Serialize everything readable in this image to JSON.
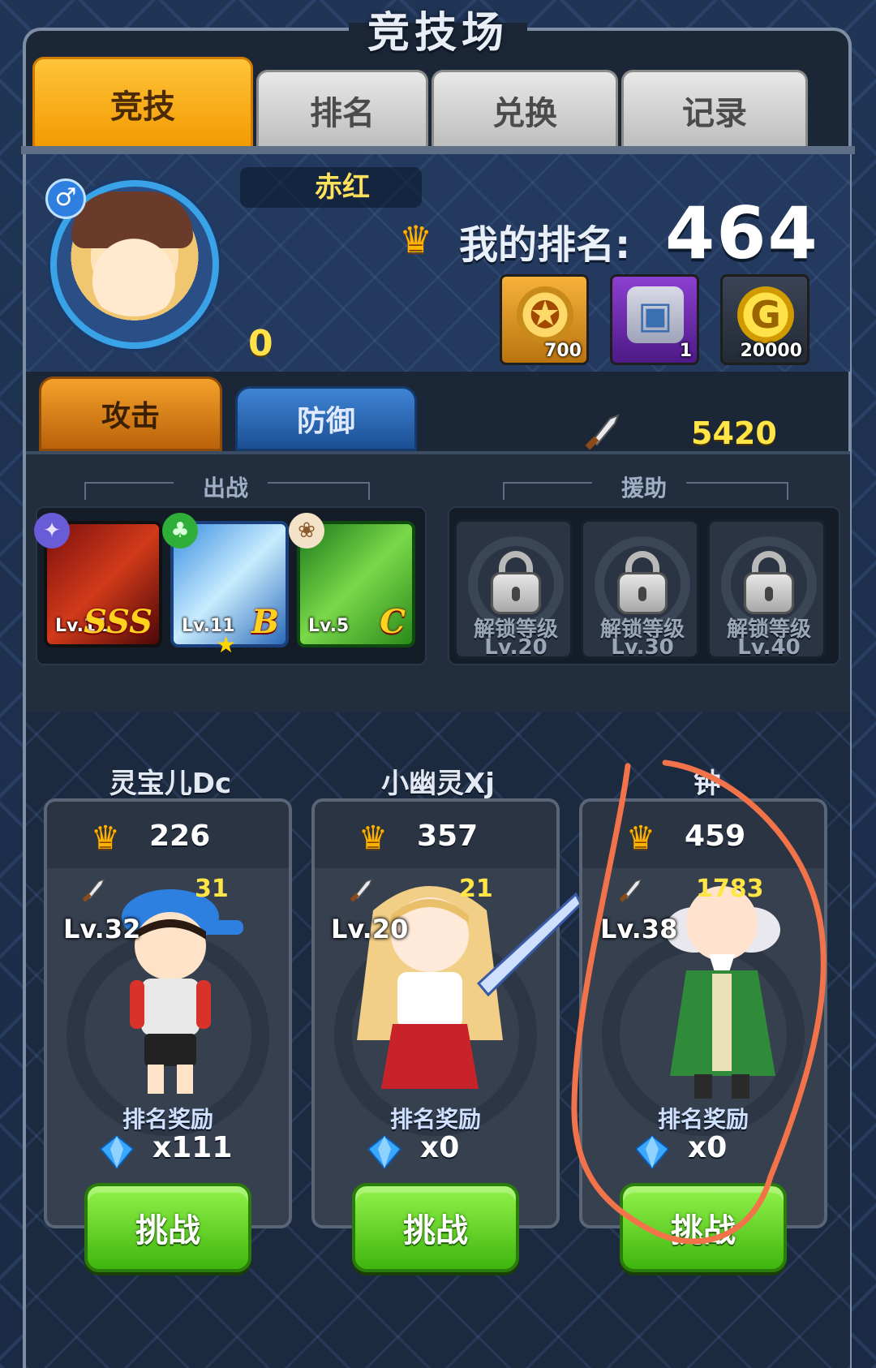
{
  "header": {
    "title": "竞技场"
  },
  "tabs": [
    {
      "label": "竞技",
      "active": true
    },
    {
      "label": "排名",
      "active": false
    },
    {
      "label": "兑换",
      "active": false
    },
    {
      "label": "记录",
      "active": false
    }
  ],
  "player": {
    "name": "赤红",
    "gender_icon": "male-icon",
    "points": "0",
    "rank_label": "我的排名:",
    "rank_value": "464",
    "rewards": [
      {
        "icon": "medal-icon",
        "qty": "700"
      },
      {
        "icon": "treasure-chest-icon",
        "qty": "1"
      },
      {
        "icon": "gold-coin-icon",
        "qty": "20000"
      }
    ]
  },
  "mode_tabs": {
    "attack": "攻击",
    "defense": "防御"
  },
  "power": {
    "icon": "sword-icon",
    "value": "5420"
  },
  "team": {
    "battle_label": "出战",
    "support_label": "援助",
    "heroes": [
      {
        "level": "Lv.11",
        "grade": "SSS",
        "element_icon": "wing-element-icon"
      },
      {
        "level": "Lv.11",
        "grade": "B",
        "element_icon": "leaf-element-icon",
        "stars": 1
      },
      {
        "level": "Lv.5",
        "grade": "C",
        "element_icon": "paw-element-icon"
      }
    ],
    "locked_slots": [
      {
        "text": "解锁等级",
        "level": "Lv.20"
      },
      {
        "text": "解锁等级",
        "level": "Lv.30"
      },
      {
        "text": "解锁等级",
        "level": "Lv.40"
      }
    ]
  },
  "opponents": [
    {
      "name": "灵宝儿Dc",
      "rank": "226",
      "power_partial": "31",
      "level": "Lv.32",
      "reward_label": "排名奖励",
      "gems": "x111",
      "button": "挑战"
    },
    {
      "name": "小幽灵Xj",
      "rank": "357",
      "power_partial": "21",
      "level": "Lv.20",
      "reward_label": "排名奖励",
      "gems": "x0",
      "button": "挑战"
    },
    {
      "name_partial": "钟",
      "rank": "459",
      "power_partial": "1783",
      "level": "Lv.38",
      "reward_label": "排名奖励",
      "gems": "x0",
      "button": "挑战"
    }
  ],
  "colors": {
    "accent": "#f29a00",
    "gold_text": "#ffe646",
    "annotation": "#f2734a",
    "button_green": "#3fb50f"
  }
}
